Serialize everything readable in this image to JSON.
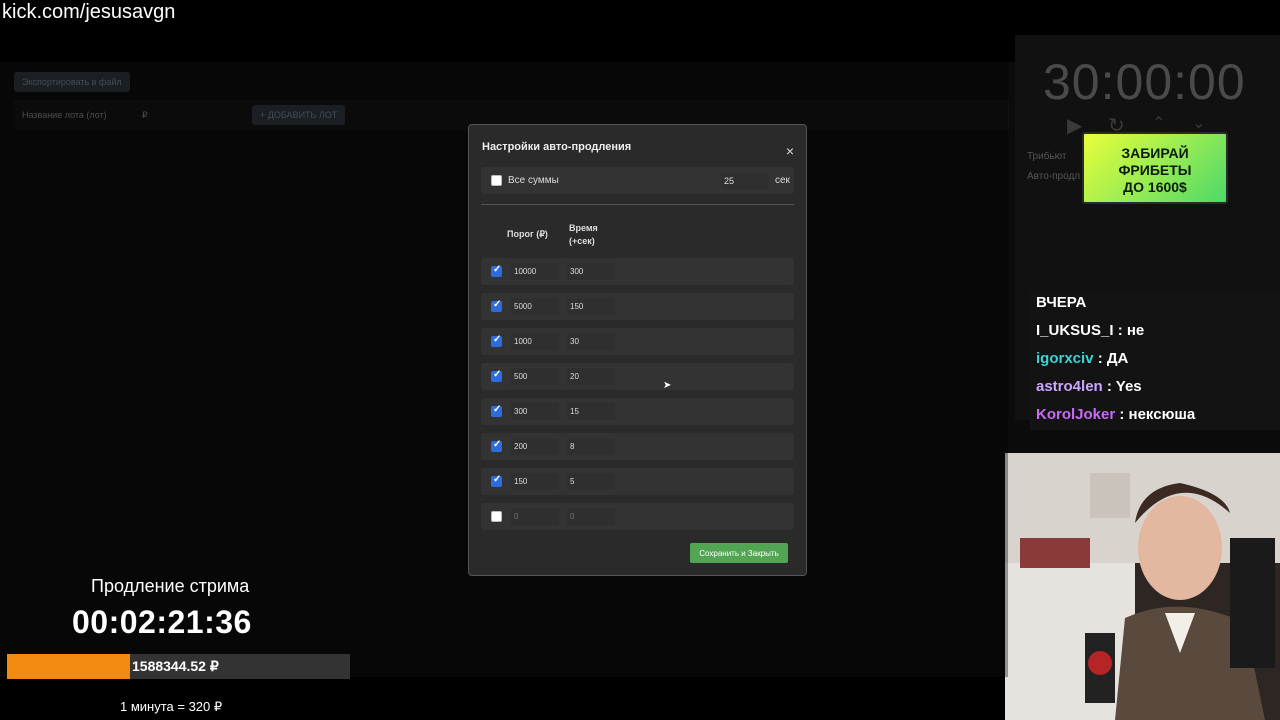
{
  "url": "kick.com/jesusavgn",
  "app": {
    "export_label": "Экспортировать в файл",
    "lot_placeholder": "Название лота (лот)",
    "price_placeholder": "₽",
    "add_label": "+ ДОБАВИТЬ ЛОТ"
  },
  "right_panel": {
    "timer": "30:00:00",
    "tribute_label": "Трибьют",
    "auto_label": "Авто-продл",
    "promo_lines": [
      "ЗАБИРАЙ",
      "ФРИБЕТЫ",
      "ДО 1600$"
    ]
  },
  "chat": [
    {
      "name": "",
      "text": "ВЧЕРА",
      "color": "#ffffff"
    },
    {
      "name": "I_UKSUS_I",
      "text": " : не",
      "color": "#ffffff"
    },
    {
      "name": "igorxciv",
      "text": " : ДА",
      "color": "#3bd4d4"
    },
    {
      "name": "astro4len",
      "text": " : Yes",
      "color": "#c8a8ff"
    },
    {
      "name": "KorolJoker",
      "text": " : нексюша",
      "color": "#c86bf5"
    }
  ],
  "modal": {
    "title": "Настройки авто-продления",
    "close": "×",
    "all_sums_label": "Все суммы",
    "all_sums_value": "25",
    "all_sums_unit": "сек",
    "col_threshold": "Порог (₽)",
    "col_time": "Время (+сек)",
    "tiers": [
      {
        "checked": true,
        "threshold": "10000",
        "time": "300"
      },
      {
        "checked": true,
        "threshold": "5000",
        "time": "150"
      },
      {
        "checked": true,
        "threshold": "1000",
        "time": "30"
      },
      {
        "checked": true,
        "threshold": "500",
        "time": "20"
      },
      {
        "checked": true,
        "threshold": "300",
        "time": "15"
      },
      {
        "checked": true,
        "threshold": "200",
        "time": "8"
      },
      {
        "checked": true,
        "threshold": "150",
        "time": "5"
      },
      {
        "checked": false,
        "threshold": "0",
        "time": "0"
      }
    ],
    "save_label": "Сохранить и Закрыть"
  },
  "extension": {
    "title": "Продление стрима",
    "timer": "00:02:21:36",
    "amount": "1588344.52 ₽",
    "progress": 0.36,
    "rate": "1 минута = 320 ₽"
  },
  "colors": {
    "accent_orange": "#f28a10",
    "save_green": "#52a552",
    "checkbox_blue": "#2d6cdf"
  }
}
